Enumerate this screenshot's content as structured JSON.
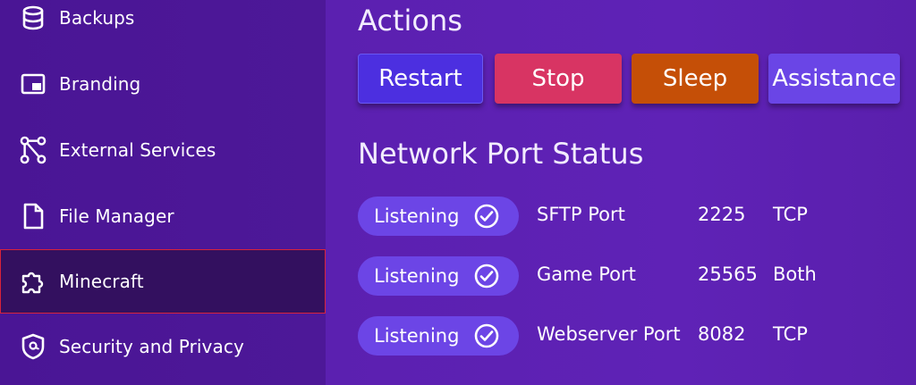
{
  "sidebar": {
    "items": [
      {
        "label": "Backups",
        "icon": "database-icon"
      },
      {
        "label": "Branding",
        "icon": "picture-in-picture-icon"
      },
      {
        "label": "External Services",
        "icon": "connections-icon"
      },
      {
        "label": "File Manager",
        "icon": "file-icon"
      },
      {
        "label": "Minecraft",
        "icon": "puzzle-icon",
        "active": true
      },
      {
        "label": "Security and Privacy",
        "icon": "shield-at-icon"
      }
    ]
  },
  "actions": {
    "title": "Actions",
    "buttons": [
      {
        "label": "Restart",
        "color": "#4c2fe0"
      },
      {
        "label": "Stop",
        "color": "#d83463"
      },
      {
        "label": "Sleep",
        "color": "#c54f07"
      },
      {
        "label": "Assistance",
        "color": "#6a45e6"
      }
    ]
  },
  "ports": {
    "title": "Network Port Status",
    "rows": [
      {
        "status": "Listening",
        "name": "SFTP Port",
        "port": "2225",
        "protocol": "TCP"
      },
      {
        "status": "Listening",
        "name": "Game Port",
        "port": "25565",
        "protocol": "Both"
      },
      {
        "status": "Listening",
        "name": "Webserver Port",
        "port": "8082",
        "protocol": "TCP"
      }
    ]
  },
  "colors": {
    "sidebar_bg": "#4a1595",
    "main_bg": "#5d21b3",
    "active_bg": "#33105f",
    "active_outline": "#d8233a",
    "pill_bg": "#6c45e6"
  }
}
